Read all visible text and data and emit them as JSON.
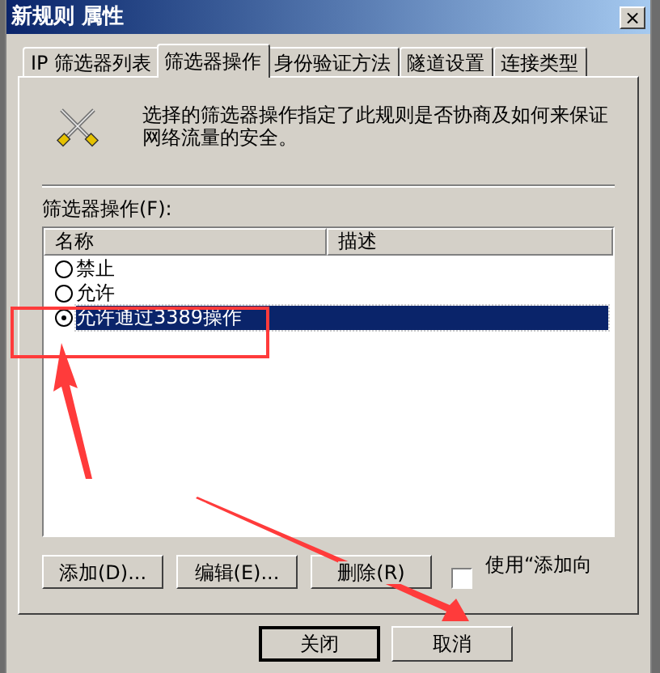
{
  "window": {
    "title": "新规则 属性",
    "close": "×"
  },
  "tabs": [
    {
      "label": "IP 筛选器列表",
      "selected": false
    },
    {
      "label": "筛选器操作",
      "selected": true
    },
    {
      "label": "身份验证方法",
      "selected": false
    },
    {
      "label": "隧道设置",
      "selected": false
    },
    {
      "label": "连接类型",
      "selected": false
    }
  ],
  "description": "选择的筛选器操作指定了此规则是否协商及如何来保证网络流量的安全。",
  "list_label": "筛选器操作(F):",
  "columns": [
    "名称",
    "描述"
  ],
  "rows": [
    {
      "name": "禁止",
      "selected": false
    },
    {
      "name": "允许",
      "selected": false
    },
    {
      "name": "允许通过3389操作",
      "selected": true
    }
  ],
  "actions": [
    "添加(D)...",
    "编辑(E)...",
    "删除(R)"
  ],
  "wizard_checkbox": {
    "label": "使用“添加向",
    "checked": false
  },
  "buttons": [
    {
      "label": "关闭",
      "default": true
    },
    {
      "label": "取消",
      "default": false
    }
  ]
}
